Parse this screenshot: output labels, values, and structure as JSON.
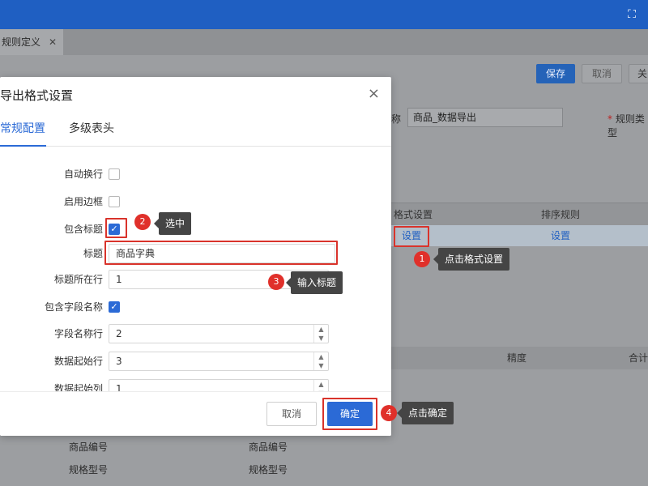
{
  "topbar": {
    "expand_icon": "expand-icon"
  },
  "tab": {
    "label": "规则定义",
    "close": "✕"
  },
  "toolbar": {
    "save": "保存",
    "cancel": "取消",
    "close": "关"
  },
  "background": {
    "name_label": "称",
    "name_value": "商品_数据导出",
    "rule_type_label": "规则类型",
    "grid_headers": [
      "格式设置",
      "排序规则"
    ],
    "grid_row": [
      "设置",
      "设置"
    ],
    "grid2_headers": [
      "精度",
      "合计"
    ],
    "bottom_rows": [
      [
        "商品编号",
        "商品编号"
      ],
      [
        "规格型号",
        "规格型号"
      ]
    ]
  },
  "dialog": {
    "title": "导出格式设置",
    "close": "×",
    "tabs": [
      "常规配置",
      "多级表头"
    ],
    "fields": {
      "auto_wrap": {
        "label": "自动换行",
        "checked": false
      },
      "border": {
        "label": "启用边框",
        "checked": false
      },
      "include_title": {
        "label": "包含标题",
        "checked": true
      },
      "title": {
        "label": "标题",
        "value": "商品字典"
      },
      "title_row": {
        "label": "标题所在行",
        "value": "1"
      },
      "include_field_names": {
        "label": "包含字段名称",
        "checked": true
      },
      "field_name_row": {
        "label": "字段名称行",
        "value": "2"
      },
      "data_start_row": {
        "label": "数据起始行",
        "value": "3"
      },
      "data_start_col": {
        "label": "数据起始列",
        "value": "1"
      }
    },
    "cancel": "取消",
    "ok": "确定"
  },
  "annotations": [
    {
      "num": "1",
      "text": "点击格式设置"
    },
    {
      "num": "2",
      "text": "选中"
    },
    {
      "num": "3",
      "text": "输入标题"
    },
    {
      "num": "4",
      "text": "点击确定"
    }
  ],
  "colors": {
    "primary": "#2b6ad6",
    "highlight": "#d9332b",
    "tooltip": "#454545",
    "topbar": "#1f5fc2"
  }
}
